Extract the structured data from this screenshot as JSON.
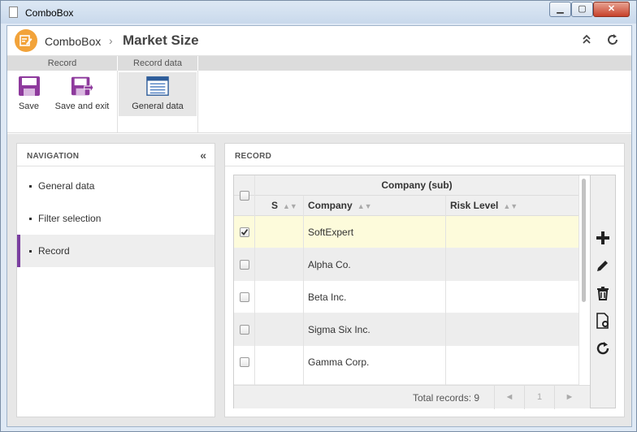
{
  "window": {
    "title": "ComboBox",
    "min_glyph": "▁",
    "max_glyph": "▢",
    "close_glyph": "✕"
  },
  "header": {
    "app_name": "ComboBox",
    "separator": "›",
    "page_title": "Market Size",
    "collapse_icon": "chevrons-up-icon",
    "refresh_icon": "refresh-icon"
  },
  "ribbon": {
    "groups": [
      {
        "label": "Record",
        "buttons": [
          {
            "label": "Save",
            "icon": "save-icon"
          },
          {
            "label": "Save and exit",
            "icon": "save-exit-icon"
          }
        ]
      },
      {
        "label": "Record data",
        "buttons": [
          {
            "label": "General data",
            "icon": "general-data-icon",
            "active": true
          }
        ]
      }
    ]
  },
  "navigation": {
    "title": "NAVIGATION",
    "collapse_glyph": "«",
    "items": [
      {
        "label": "General data",
        "active": false
      },
      {
        "label": "Filter selection",
        "active": false
      },
      {
        "label": "Record",
        "active": true
      }
    ]
  },
  "record": {
    "title": "RECORD",
    "group_header": "Company (sub)",
    "columns": [
      "S",
      "Company",
      "Risk Level"
    ],
    "rows": [
      {
        "company": "SoftExpert",
        "risk": "",
        "checked": true,
        "selected": true
      },
      {
        "company": "Alpha Co.",
        "risk": "",
        "checked": false
      },
      {
        "company": "Beta Inc.",
        "risk": "",
        "checked": false
      },
      {
        "company": "Sigma Six Inc.",
        "risk": "",
        "checked": false
      },
      {
        "company": "Gamma Corp.",
        "risk": "",
        "checked": false
      }
    ],
    "total_records": "Total records: 9",
    "pagination": {
      "prev": "◄",
      "page": "1",
      "next": "►"
    },
    "tools": [
      "add-icon",
      "edit-icon",
      "delete-icon",
      "document-settings-icon",
      "refresh-icon"
    ]
  },
  "colors": {
    "accent": "#7b3fa0",
    "logo": "#f2a33a",
    "selected_row": "#fdfbdb",
    "stripe": "#ededed"
  }
}
